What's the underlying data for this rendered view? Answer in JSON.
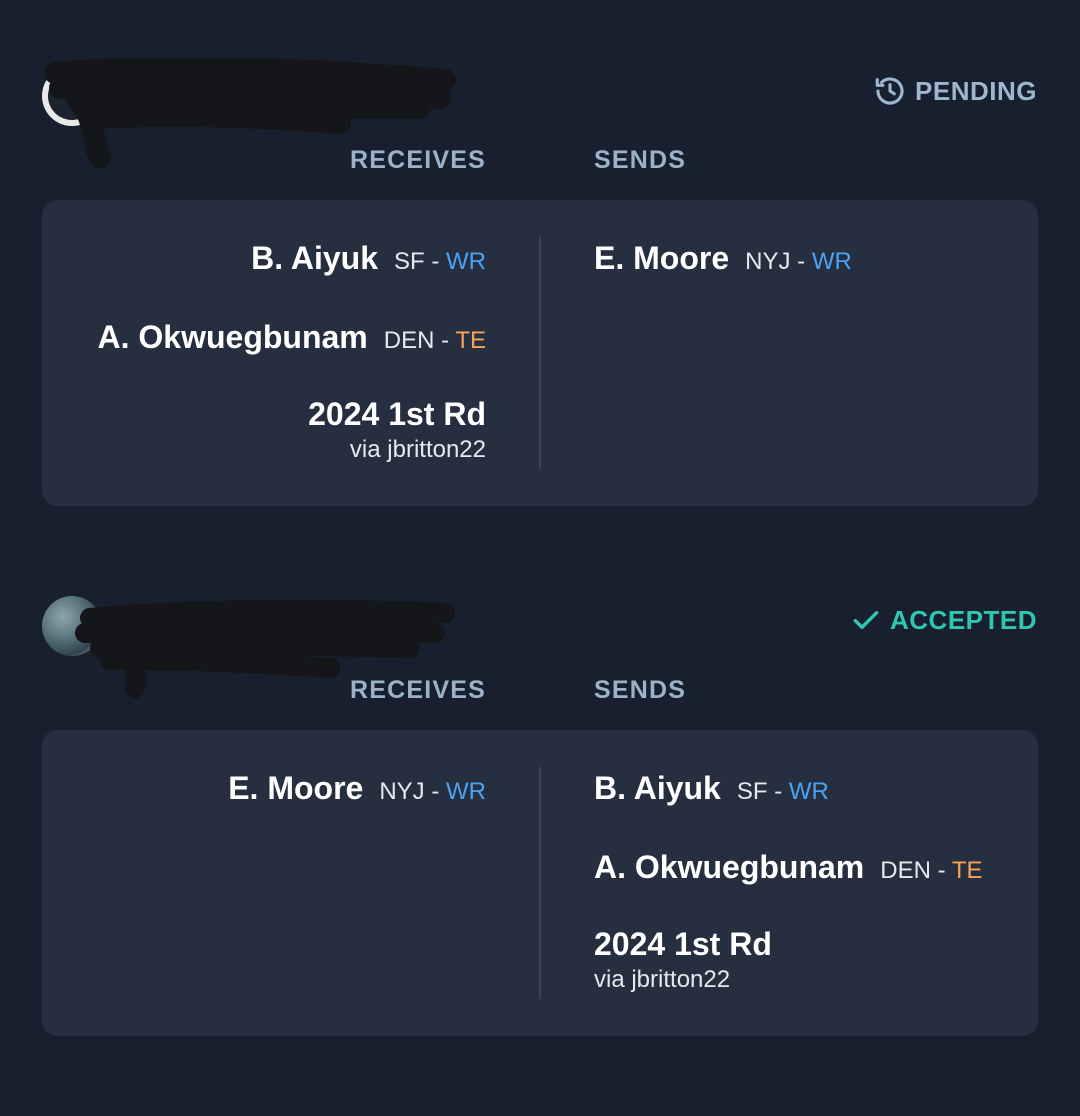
{
  "trades": [
    {
      "status": "PENDING",
      "receives_label": "RECEIVES",
      "sends_label": "SENDS",
      "receives": [
        {
          "name": "B. Aiyuk",
          "team": "SF",
          "pos": "WR"
        },
        {
          "name": "A. Okwuegbunam",
          "team": "DEN",
          "pos": "TE"
        },
        {
          "pick": "2024 1st Rd",
          "via": "via jbritton22"
        }
      ],
      "sends": [
        {
          "name": "E. Moore",
          "team": "NYJ",
          "pos": "WR"
        }
      ]
    },
    {
      "status": "ACCEPTED",
      "receives_label": "RECEIVES",
      "sends_label": "SENDS",
      "receives": [
        {
          "name": "E. Moore",
          "team": "NYJ",
          "pos": "WR"
        }
      ],
      "sends": [
        {
          "name": "B. Aiyuk",
          "team": "SF",
          "pos": "WR"
        },
        {
          "name": "A. Okwuegbunam",
          "team": "DEN",
          "pos": "TE"
        },
        {
          "pick": "2024 1st Rd",
          "via": "via jbritton22"
        }
      ]
    }
  ],
  "separator": "-",
  "colors": {
    "background": "#18202f",
    "card": "#262f40",
    "pending": "#9fb6cf",
    "accepted": "#2ec7b3",
    "wr": "#4aa3f5",
    "te": "#f5a25b"
  },
  "icons": {
    "pending": "history-clock-icon",
    "accepted": "checkmark-icon"
  }
}
